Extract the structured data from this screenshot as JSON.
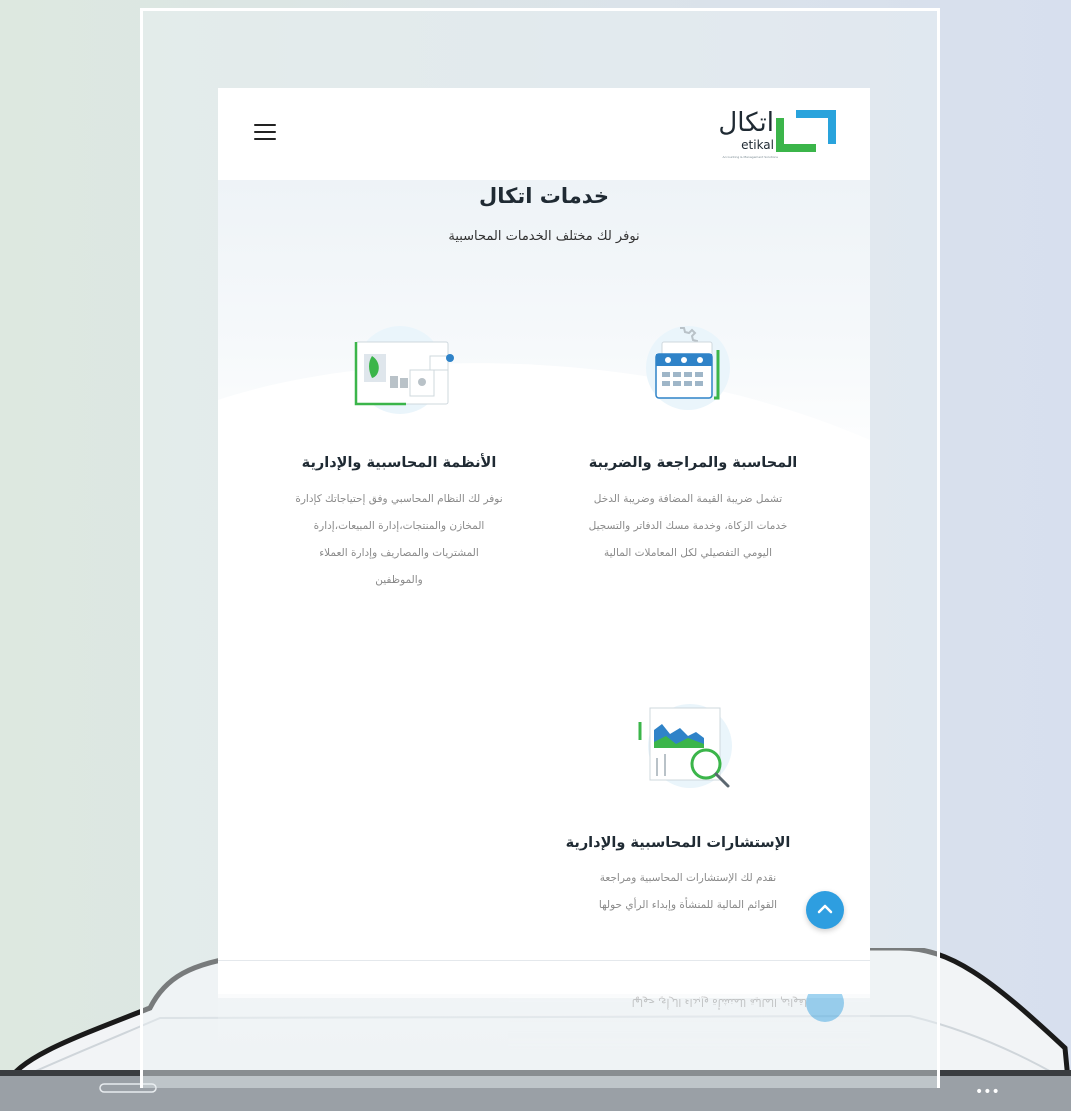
{
  "brand": {
    "name_ar": "اتكال",
    "name_en": "etikal",
    "tagline": "Accounting & Management Solutions"
  },
  "header": {
    "menu_icon": "hamburger-menu-icon"
  },
  "hero": {
    "title": "خدمات اتكال",
    "subtitle": "نوفر لك مختلف الخدمات المحاسبية"
  },
  "services": [
    {
      "icon": "calendar-accounting-icon",
      "title": "المحاسبة والمراجعة والضريبة",
      "desc_lines": [
        "تشمل ضريبة القيمة المضافة وضريبة الدخل",
        "خدمات الزكاة، وخدمة مسك الدفاتر والتسجيل",
        "اليومي التفصيلي لكل المعاملات المالية"
      ]
    },
    {
      "icon": "systems-dashboard-icon",
      "title": "الأنظمة المحاسبية والإدارية",
      "desc_lines": [
        "نوفر لك النظام المحاسبي وفق إحتياجاتك كإدارة",
        "المخازن والمنتجات،إدارة المبيعات،إدارة",
        "المشتريات والمصاريف وإدارة العملاء",
        "والموظفين"
      ]
    },
    {
      "icon": "consulting-magnifier-icon",
      "title": "الإستشارات المحاسبية والإدارية",
      "desc_lines": [
        "نقدم لك الإستشارات المحاسبية ومراجعة",
        "القوائم المالية للمنشأة وإبداء الرأي حولها"
      ]
    }
  ],
  "scroll_top": {
    "icon": "chevron-up-icon"
  },
  "device": {
    "menu_dots": "•••"
  },
  "colors": {
    "brand_green": "#3bb54a",
    "brand_blue": "#29a3dc",
    "accent_blue": "#2e9ee0",
    "heading": "#1f2a33",
    "muted": "#8a8a8a"
  }
}
